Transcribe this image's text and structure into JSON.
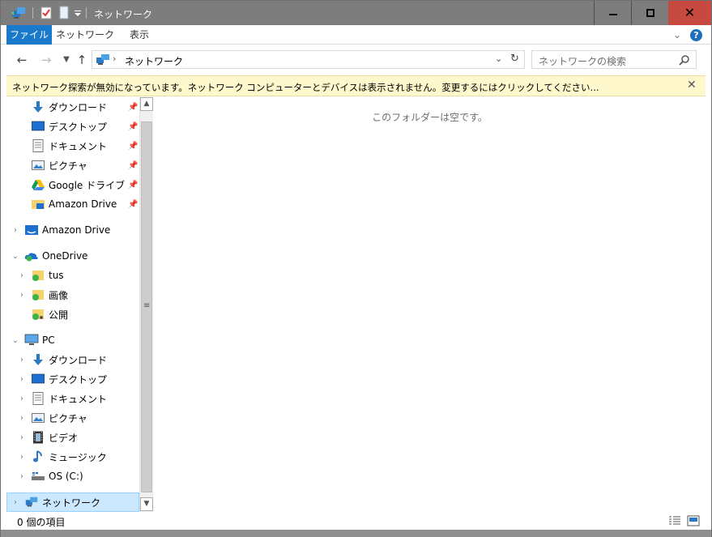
{
  "window": {
    "title": "ネットワーク",
    "colors": {
      "titlebar": "#7d7d7d",
      "close": "#c64a3f",
      "accent": "#1979ca",
      "infobar": "#fff8cc",
      "selection": "#cce8ff"
    }
  },
  "ribbon": {
    "tabs": [
      {
        "label": "ファイル",
        "active": true
      },
      {
        "label": "ネットワーク",
        "active": false
      },
      {
        "label": "表示",
        "active": false
      }
    ],
    "help_label": "?"
  },
  "address": {
    "path": "ネットワーク",
    "search_placeholder": "ネットワークの検索"
  },
  "infobar": {
    "message": "ネットワーク探索が無効になっています。ネットワーク コンピューターとデバイスは表示されません。変更するにはクリックしてください..."
  },
  "navpane": {
    "quick_access": [
      {
        "label": "ダウンロード",
        "icon": "download-icon",
        "pinned": true
      },
      {
        "label": "デスクトップ",
        "icon": "desktop-icon",
        "pinned": true
      },
      {
        "label": "ドキュメント",
        "icon": "documents-icon",
        "pinned": true
      },
      {
        "label": "ピクチャ",
        "icon": "pictures-icon",
        "pinned": true
      },
      {
        "label": "Google ドライブ",
        "icon": "google-drive-icon",
        "pinned": true
      },
      {
        "label": "Amazon Drive",
        "icon": "amazon-drive-folder-icon",
        "pinned": true
      }
    ],
    "amazon_drive": {
      "label": "Amazon Drive"
    },
    "onedrive": {
      "label": "OneDrive",
      "children": [
        {
          "label": "tus"
        },
        {
          "label": "画像"
        },
        {
          "label": "公開"
        }
      ]
    },
    "pc": {
      "label": "PC",
      "children": [
        {
          "label": "ダウンロード",
          "icon": "download-icon"
        },
        {
          "label": "デスクトップ",
          "icon": "desktop-icon"
        },
        {
          "label": "ドキュメント",
          "icon": "documents-icon"
        },
        {
          "label": "ピクチャ",
          "icon": "pictures-icon"
        },
        {
          "label": "ビデオ",
          "icon": "videos-icon"
        },
        {
          "label": "ミュージック",
          "icon": "music-icon"
        },
        {
          "label": "OS (C:)",
          "icon": "drive-icon"
        }
      ]
    },
    "network": {
      "label": "ネットワーク",
      "selected": true
    }
  },
  "content": {
    "empty_message": "このフォルダーは空です。"
  },
  "status": {
    "item_count": "0 個の項目"
  }
}
